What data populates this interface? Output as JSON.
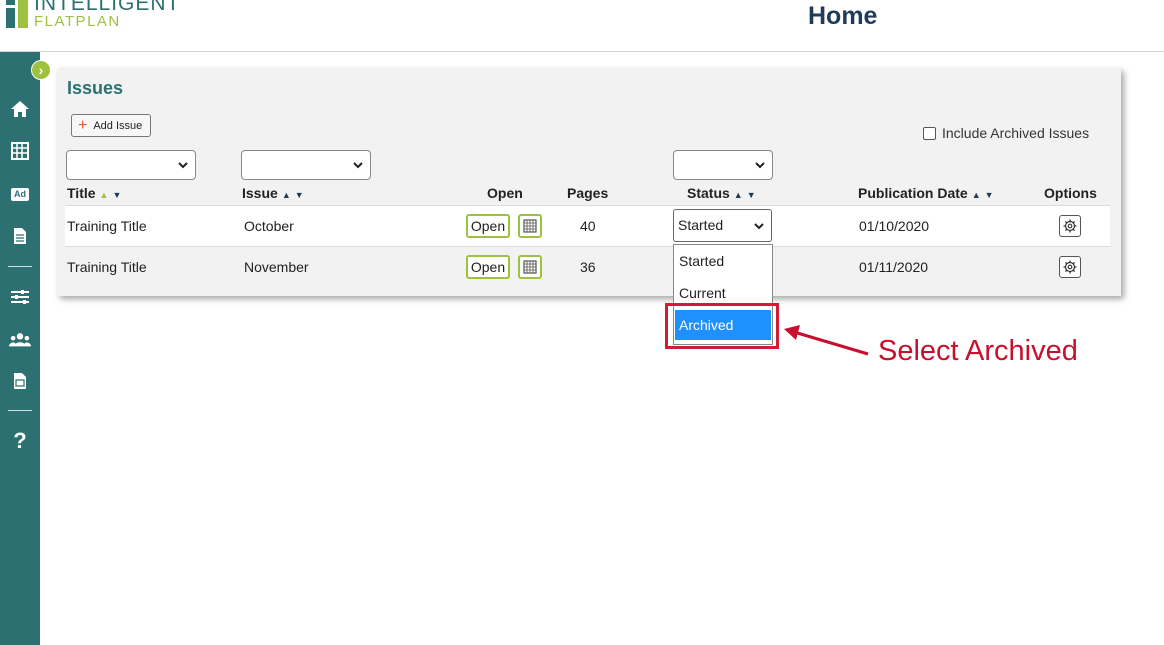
{
  "header": {
    "logo_line1": "INTELLIGENT",
    "logo_line2": "FLATPLAN",
    "title": "Home"
  },
  "sidebar": {
    "items": [
      {
        "icon": "home-icon"
      },
      {
        "icon": "flatplan-grid-icon"
      },
      {
        "icon": "ad-icon",
        "label": "Ad"
      },
      {
        "icon": "document-icon"
      },
      {
        "icon": "sliders-icon"
      },
      {
        "icon": "users-icon"
      },
      {
        "icon": "report-icon"
      },
      {
        "icon": "help-icon",
        "label": "?"
      }
    ]
  },
  "panel": {
    "title": "Issues",
    "add_issue_label": "Add Issue",
    "include_archived_label": "Include Archived Issues",
    "columns": [
      "Title",
      "Issue",
      "Open",
      "Pages",
      "Status",
      "Publication Date",
      "Options"
    ],
    "rows": [
      {
        "title": "Training Title",
        "issue": "October",
        "open": "Open",
        "pages": "40",
        "status": "Started",
        "publication_date": "01/10/2020"
      },
      {
        "title": "Training Title",
        "issue": "November",
        "open": "Open",
        "pages": "36",
        "status": "",
        "publication_date": "01/11/2020"
      }
    ]
  },
  "status_dropdown": {
    "options": [
      "Started",
      "Current",
      "Archived"
    ],
    "highlighted": "Archived"
  },
  "annotation": {
    "text": "Select Archived",
    "color": "#c8102e"
  },
  "colors": {
    "teal": "#2d7072",
    "green": "#9ec23f",
    "selection": "#1e90ff"
  }
}
